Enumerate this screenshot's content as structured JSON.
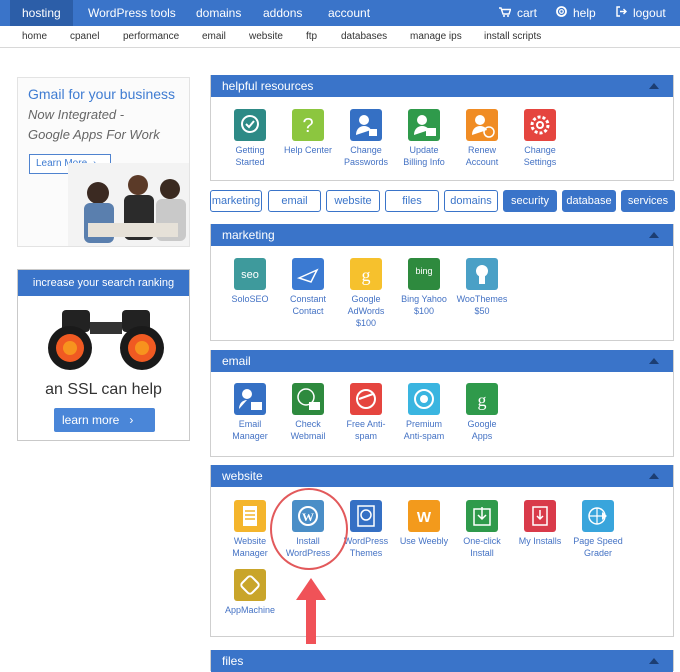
{
  "topnav": {
    "tabs": [
      "hosting",
      "WordPress tools",
      "domains",
      "addons",
      "account"
    ],
    "right": [
      {
        "icon": "cart-icon",
        "label": "cart"
      },
      {
        "icon": "help-icon",
        "label": "help"
      },
      {
        "icon": "logout-icon",
        "label": "logout"
      }
    ]
  },
  "subnav": [
    "home",
    "cpanel",
    "performance",
    "email",
    "website",
    "ftp",
    "databases",
    "manage ips",
    "install scripts"
  ],
  "ads": {
    "gmail": {
      "line1": "Gmail for your business",
      "line2": "Now Integrated -",
      "line3": "Google Apps For Work",
      "button": "Learn More"
    },
    "ssl": {
      "header": "increase your search ranking",
      "tagline": "an SSL can help",
      "button": "learn more"
    }
  },
  "helpful": {
    "title": "helpful resources",
    "items": [
      {
        "l1": "Getting",
        "l2": "Started",
        "color": "#2e8a86"
      },
      {
        "l1": "Help Center",
        "l2": "",
        "color": "#8cc63f"
      },
      {
        "l1": "Change",
        "l2": "Passwords",
        "color": "#3570c4"
      },
      {
        "l1": "Update",
        "l2": "Billing Info",
        "color": "#2f9a4b"
      },
      {
        "l1": "Renew",
        "l2": "Account",
        "color": "#f08c24"
      },
      {
        "l1": "Change",
        "l2": "Settings",
        "color": "#e5453f"
      }
    ]
  },
  "filters": [
    "marketing",
    "email",
    "website",
    "files",
    "domains",
    "security",
    "database",
    "services"
  ],
  "marketing": {
    "title": "marketing",
    "items": [
      {
        "l1": "SoloSEO",
        "l2": "",
        "l3": "",
        "color": "#3e9a9c",
        "glyph": "seo"
      },
      {
        "l1": "Constant",
        "l2": "Contact",
        "l3": "",
        "color": "#3b7ad2",
        "glyph": ""
      },
      {
        "l1": "Google",
        "l2": "AdWords",
        "l3": "$100",
        "color": "#f6c12d",
        "glyph": "g"
      },
      {
        "l1": "Bing Yahoo",
        "l2": "$100",
        "l3": "",
        "color": "#2e8a3e",
        "glyph": "bing"
      },
      {
        "l1": "WooThemes",
        "l2": "$50",
        "l3": "",
        "color": "#4aa0c6",
        "glyph": ""
      }
    ]
  },
  "email": {
    "title": "email",
    "items": [
      {
        "l1": "Email",
        "l2": "Manager",
        "color": "#3570c4"
      },
      {
        "l1": "Check",
        "l2": "Webmail",
        "color": "#2e8a3e"
      },
      {
        "l1": "Free Anti-",
        "l2": "spam",
        "color": "#e5453f"
      },
      {
        "l1": "Premium",
        "l2": "Anti-spam",
        "color": "#3ab5e0"
      },
      {
        "l1": "Google",
        "l2": "Apps",
        "color": "#2f9a4b"
      }
    ]
  },
  "website": {
    "title": "website",
    "items": [
      {
        "l1": "Website",
        "l2": "Manager",
        "color": "#f4b52c"
      },
      {
        "l1": "Install",
        "l2": "WordPress",
        "color": "#4a8ec7"
      },
      {
        "l1": "WordPress",
        "l2": "Themes",
        "color": "#3570c4"
      },
      {
        "l1": "Use Weebly",
        "l2": "",
        "color": "#f39a1c"
      },
      {
        "l1": "One-click",
        "l2": "Install",
        "color": "#2f9a4b"
      },
      {
        "l1": "My Installs",
        "l2": "",
        "color": "#d93a4a"
      },
      {
        "l1": "Page Speed",
        "l2": "Grader",
        "color": "#39a5dc"
      },
      {
        "l1": "AppMachine",
        "l2": "",
        "color": "#c9a52a"
      }
    ]
  },
  "files": {
    "title": "files"
  }
}
